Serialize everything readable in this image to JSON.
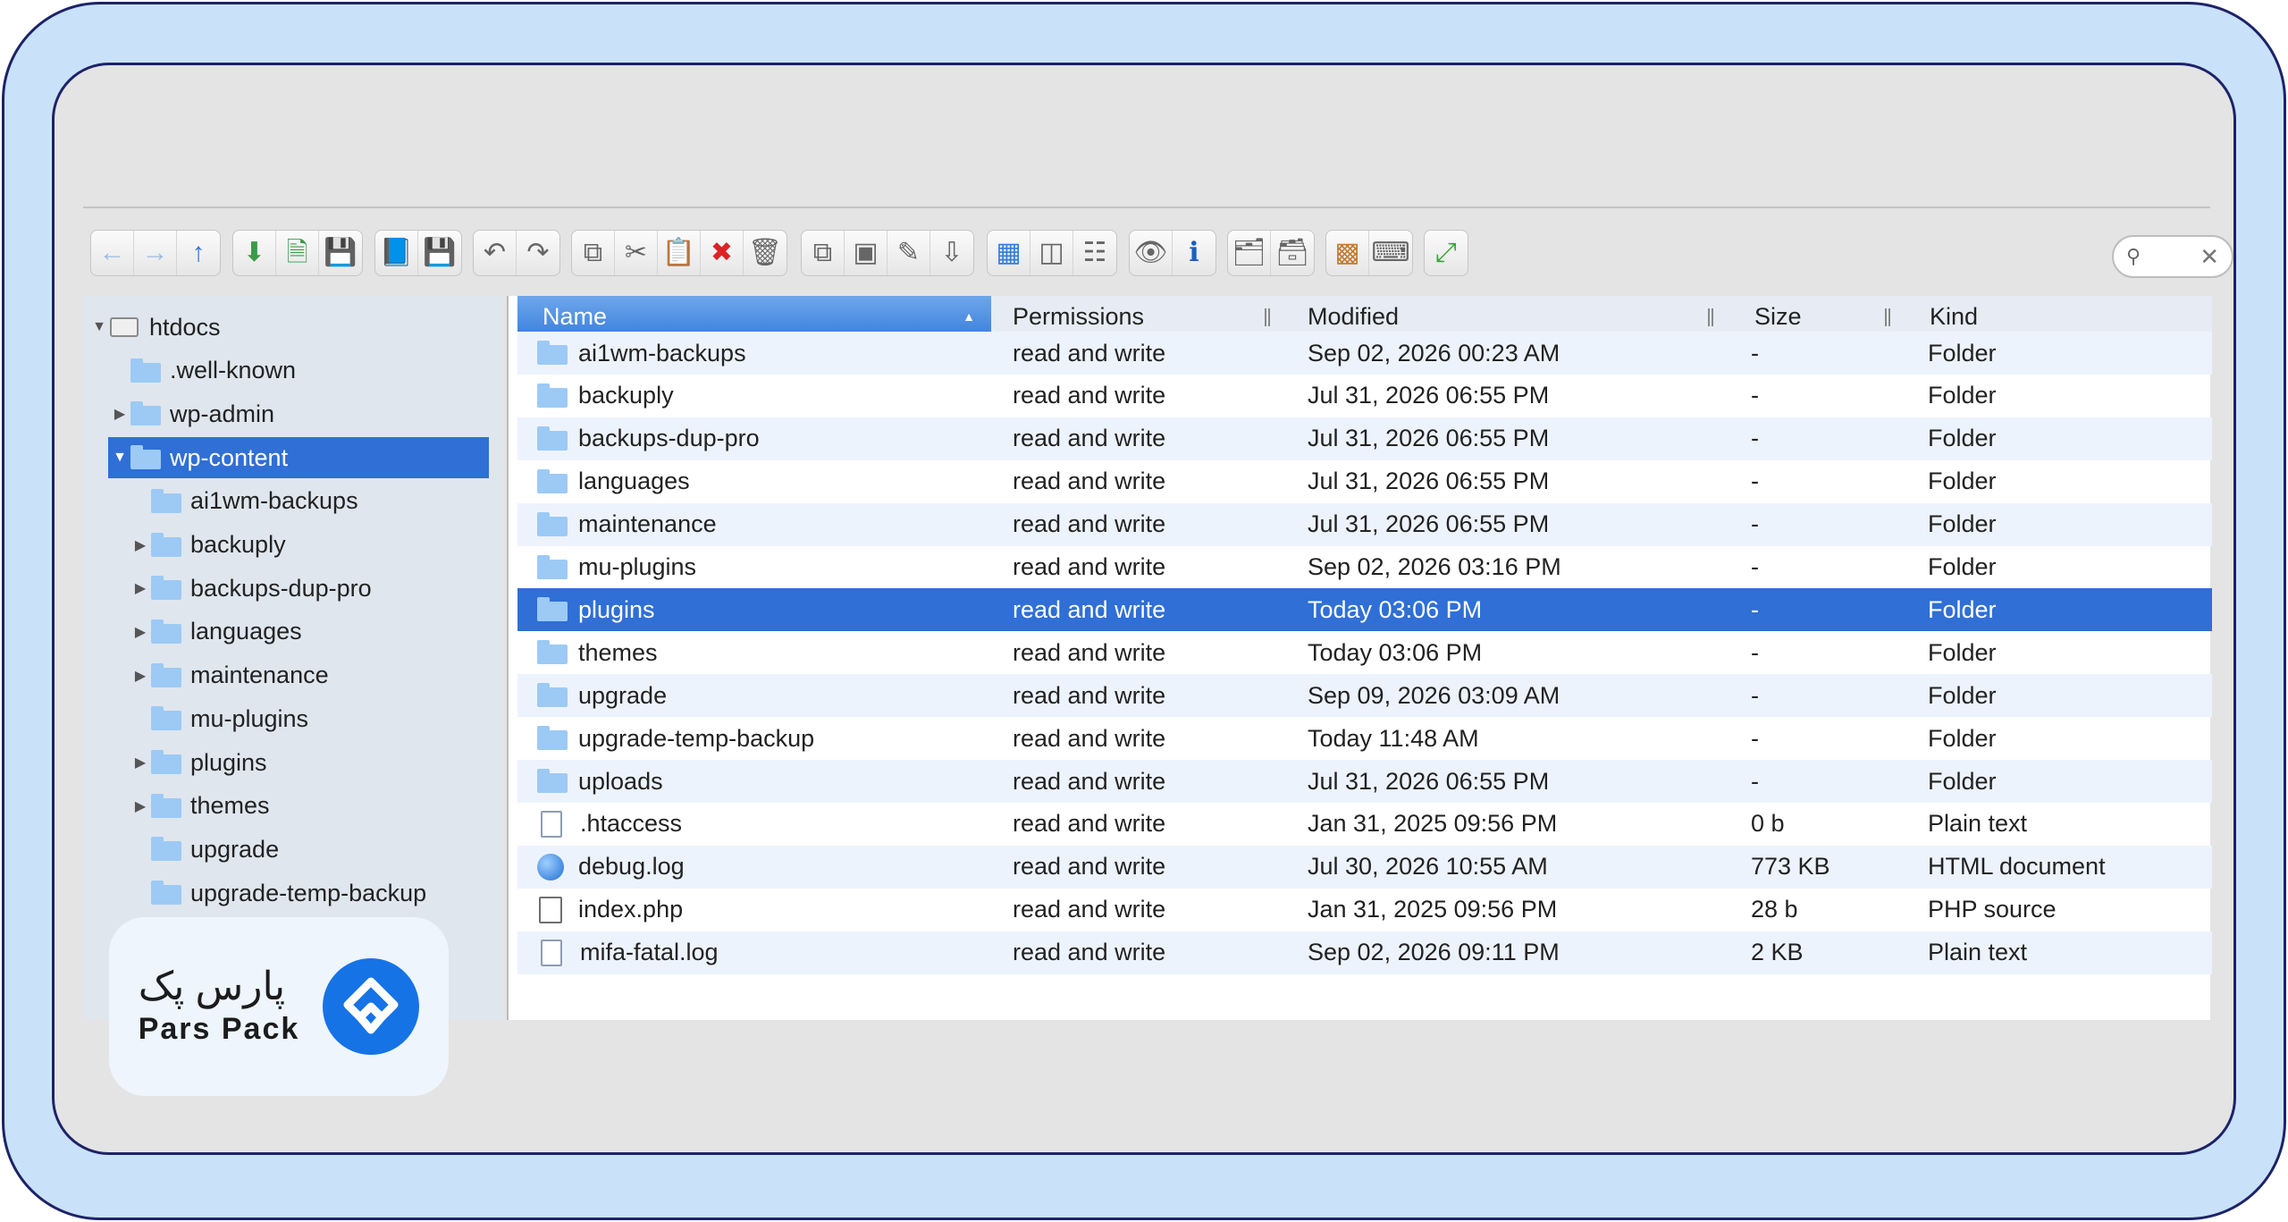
{
  "toolbar": {
    "groups": [
      [
        "arrow-left-icon",
        "arrow-right-icon",
        "arrow-up-icon"
      ],
      [
        "download-icon",
        "new-file-icon",
        "save-icon"
      ],
      [
        "book-icon",
        "floppy-icon"
      ],
      [
        "undo-icon",
        "redo-icon"
      ],
      [
        "copy-icon",
        "cut-icon",
        "paste-icon",
        "delete-icon",
        "trash-icon"
      ],
      [
        "duplicate-icon",
        "select-icon",
        "edit-icon",
        "extract-icon"
      ],
      [
        "grid-view-icon",
        "icons-view-icon",
        "list-view-icon"
      ],
      [
        "preview-eye-icon",
        "info-icon"
      ],
      [
        "archive-icon",
        "unarchive-icon"
      ],
      [
        "apps-grid-icon",
        "rename-icon"
      ],
      [
        "fullscreen-icon"
      ]
    ],
    "search": {
      "placeholder": ""
    }
  },
  "sidebar": {
    "items": [
      {
        "label": "htdocs",
        "depth": 0,
        "arrow": "down",
        "type": "drive"
      },
      {
        "label": ".well-known",
        "depth": 1,
        "arrow": "",
        "type": "folder"
      },
      {
        "label": "wp-admin",
        "depth": 1,
        "arrow": "right",
        "type": "folder"
      },
      {
        "label": "wp-content",
        "depth": 1,
        "arrow": "down",
        "type": "folder",
        "selected": true
      },
      {
        "label": "ai1wm-backups",
        "depth": 2,
        "arrow": "",
        "type": "folder"
      },
      {
        "label": "backuply",
        "depth": 2,
        "arrow": "right",
        "type": "folder"
      },
      {
        "label": "backups-dup-pro",
        "depth": 2,
        "arrow": "right",
        "type": "folder"
      },
      {
        "label": "languages",
        "depth": 2,
        "arrow": "right",
        "type": "folder"
      },
      {
        "label": "maintenance",
        "depth": 2,
        "arrow": "right",
        "type": "folder"
      },
      {
        "label": "mu-plugins",
        "depth": 2,
        "arrow": "",
        "type": "folder"
      },
      {
        "label": "plugins",
        "depth": 2,
        "arrow": "right",
        "type": "folder"
      },
      {
        "label": "themes",
        "depth": 2,
        "arrow": "right",
        "type": "folder"
      },
      {
        "label": "upgrade",
        "depth": 2,
        "arrow": "",
        "type": "folder"
      },
      {
        "label": "upgrade-temp-backup",
        "depth": 2,
        "arrow": "",
        "type": "folder"
      }
    ]
  },
  "filelist": {
    "columns": {
      "name": "Name",
      "permissions": "Permissions",
      "modified": "Modified",
      "size": "Size",
      "kind": "Kind"
    },
    "rows": [
      {
        "name": "ai1wm-backups",
        "perm": "read and write",
        "mod": "Sep 02, 2026 00:23 AM",
        "size": "-",
        "kind": "Folder",
        "icon": "folder"
      },
      {
        "name": "backuply",
        "perm": "read and write",
        "mod": "Jul 31, 2026 06:55 PM",
        "size": "-",
        "kind": "Folder",
        "icon": "folder"
      },
      {
        "name": "backups-dup-pro",
        "perm": "read and write",
        "mod": "Jul 31, 2026 06:55 PM",
        "size": "-",
        "kind": "Folder",
        "icon": "folder"
      },
      {
        "name": "languages",
        "perm": "read and write",
        "mod": "Jul 31, 2026 06:55 PM",
        "size": "-",
        "kind": "Folder",
        "icon": "folder"
      },
      {
        "name": "maintenance",
        "perm": "read and write",
        "mod": "Jul 31, 2026 06:55 PM",
        "size": "-",
        "kind": "Folder",
        "icon": "folder"
      },
      {
        "name": "mu-plugins",
        "perm": "read and write",
        "mod": "Sep 02, 2026 03:16 PM",
        "size": "-",
        "kind": "Folder",
        "icon": "folder"
      },
      {
        "name": "plugins",
        "perm": "read and write",
        "mod": "Today 03:06 PM",
        "size": "-",
        "kind": "Folder",
        "icon": "folder",
        "selected": true
      },
      {
        "name": "themes",
        "perm": "read and write",
        "mod": "Today 03:06 PM",
        "size": "-",
        "kind": "Folder",
        "icon": "folder"
      },
      {
        "name": "upgrade",
        "perm": "read and write",
        "mod": "Sep 09, 2026 03:09 AM",
        "size": "-",
        "kind": "Folder",
        "icon": "folder"
      },
      {
        "name": "upgrade-temp-backup",
        "perm": "read and write",
        "mod": "Today 11:48 AM",
        "size": "-",
        "kind": "Folder",
        "icon": "folder"
      },
      {
        "name": "uploads",
        "perm": "read and write",
        "mod": "Jul 31, 2026 06:55 PM",
        "size": "-",
        "kind": "Folder",
        "icon": "folder"
      },
      {
        "name": ".htaccess",
        "perm": "read and write",
        "mod": "Jan 31, 2025 09:56 PM",
        "size": "0 b",
        "kind": "Plain text",
        "icon": "text"
      },
      {
        "name": "debug.log",
        "perm": "read and write",
        "mod": "Jul 30, 2026 10:55 AM",
        "size": "773 KB",
        "kind": "HTML document",
        "icon": "globe"
      },
      {
        "name": "index.php",
        "perm": "read and write",
        "mod": "Jan 31, 2025 09:56 PM",
        "size": "28 b",
        "kind": "PHP source",
        "icon": "php"
      },
      {
        "name": "mifa-fatal.log",
        "perm": "read and write",
        "mod": "Sep 02, 2026 09:11 PM",
        "size": "2 KB",
        "kind": "Plain text",
        "icon": "text"
      }
    ]
  },
  "logo": {
    "fa": "پارس پک",
    "en": "Pars Pack"
  },
  "colors": {
    "accent": "#2f6fd6",
    "frame_outer": "#c9e2fa",
    "frame_border": "#1d2368",
    "brand": "#1673e6"
  }
}
